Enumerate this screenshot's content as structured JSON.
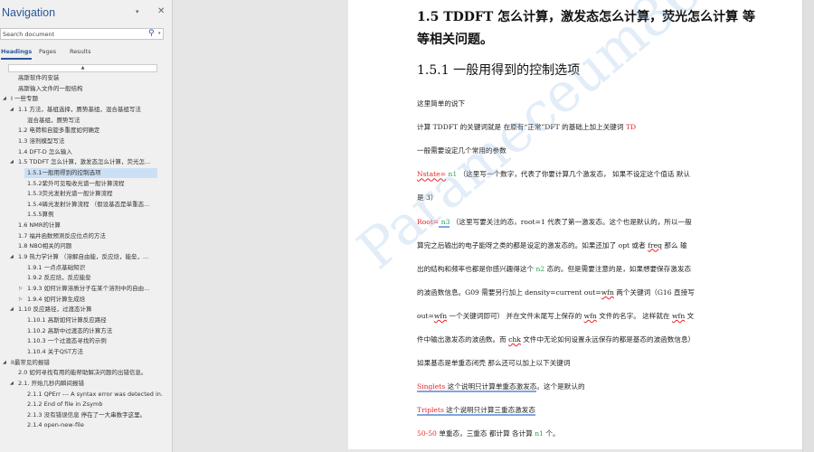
{
  "nav": {
    "title": "Navigation",
    "pin_icon": "▾",
    "close_icon": "✕",
    "search_placeholder": "Search document",
    "search_icon": "⚲",
    "search_dropdown": "▾",
    "tabs": [
      "Headings",
      "Pages",
      "Results"
    ],
    "collapse_icon": "▲",
    "items": [
      {
        "label": "高斯软件的安装",
        "level": 1
      },
      {
        "label": "高斯输入文件的一般结构",
        "level": 1
      },
      {
        "label": "I 一些专题",
        "level": 0,
        "arrow": "◢"
      },
      {
        "label": "1.1 方法，基组选择，赝势基组，混合基组写法",
        "level": 1,
        "arrow": "◢"
      },
      {
        "label": "混合基组，赝势写法",
        "level": 2
      },
      {
        "label": "1.2 电荷和自旋多重度如何确定",
        "level": 1
      },
      {
        "label": "1.3 溶剂模型写法",
        "level": 1
      },
      {
        "label": "1.4 DFT-D 怎么输入",
        "level": 1
      },
      {
        "label": "1.5 TDDFT 怎么计算，激发态怎么计算，荧光怎...",
        "level": 1,
        "arrow": "◢"
      },
      {
        "label": "1.5.1一般用得到的控制选项",
        "level": 2,
        "selected": true
      },
      {
        "label": "1.5.2紫外可见吸收光谱一般计算流程",
        "level": 2
      },
      {
        "label": "1.5.3荧光发射光谱一般计算流程",
        "level": 2
      },
      {
        "label": "1.5.4磷光发射计算流程 （假设基态是单重态...",
        "level": 2
      },
      {
        "label": "1.5.5算例",
        "level": 2
      },
      {
        "label": "1.6 NMR的计算",
        "level": 1
      },
      {
        "label": "1.7 福井函数预测反应位点的方法",
        "level": 1
      },
      {
        "label": "1.8 NBO相关的问题",
        "level": 1
      },
      {
        "label": "1.9 热力学计算 （溶解自由能，反应焓，能垒，...",
        "level": 1,
        "arrow": "◢"
      },
      {
        "label": "1.9.1 一点点基础知识",
        "level": 2
      },
      {
        "label": "1.9.2 反应焓，反应能垒",
        "level": 2
      },
      {
        "label": "1.9.3 如何计算溶质分子在某个溶剂中的自由...",
        "level": 2,
        "arrow": "▷"
      },
      {
        "label": "1.9.4 如何计算生成焓",
        "level": 2,
        "arrow": "▷"
      },
      {
        "label": "1.10 反应路径，过渡态计算",
        "level": 1,
        "arrow": "◢"
      },
      {
        "label": "1.10.1 高斯如何计算反应路径",
        "level": 2
      },
      {
        "label": "1.10.2 高斯中过渡态的计算方法",
        "level": 2
      },
      {
        "label": "1.10.3 一个过渡态寻找的示例",
        "level": 2
      },
      {
        "label": "1.10.4 关于QST方法",
        "level": 2
      },
      {
        "label": "II最常见的报错",
        "level": 0,
        "arrow": "◢"
      },
      {
        "label": "2.0 如何寻找有用的能帮助解决问题的出错信息。",
        "level": 1
      },
      {
        "label": "2.1. 开始几秒内瞬间报错",
        "level": 1,
        "arrow": "◢"
      },
      {
        "label": "2.1.1 QPErr --- A syntax error was detected in...",
        "level": 2
      },
      {
        "label": "2.1.2 End of file in Zsymb",
        "level": 2
      },
      {
        "label": "2.1.3 没有错误信息 停在了一大串数字这里。",
        "level": 2
      },
      {
        "label": "2.1.4 open-new-file",
        "level": 2
      }
    ]
  },
  "doc": {
    "heading1_line1": "1.5 TDDFT  怎么计算，激发态怎么计算，荧光怎么计算  等",
    "heading1_line2": "等相关问题。",
    "heading2": "1.5.1 一般用得到的控制选项",
    "watermark": "Parameceum86",
    "lines": [
      [
        {
          "t": "这里简单的说下"
        }
      ],
      [
        {
          "t": "计算 TDDFT 的关键词就是  在原有“正常”DFT 的基础上加上关键词 "
        },
        {
          "t": "TD",
          "c": "red"
        }
      ],
      [
        {
          "t": "一般需要设定几个常用的参数"
        }
      ],
      [
        {
          "t": "Nstate=",
          "c": "red sq"
        },
        {
          "t": " n1",
          "c": "green"
        },
        {
          "t": "  （这里写一个数字，代表了你要计算几个激发态，  如果不设定这个值话  默认"
        }
      ],
      [
        {
          "t": "是 3）"
        }
      ],
      [
        {
          "t": "Root=",
          "c": "red"
        },
        {
          "t": "   n3",
          "c": "green bu"
        },
        {
          "t": "    （这里写要关注的态，root=1 代表了第一激发态。这个也是默认的，所以一般"
        }
      ],
      [
        {
          "t": "算完之后输出的电子能呀之类的都是设定的激发态的。如果还加了  opt 或者 "
        },
        {
          "t": "freq",
          "c": "sq"
        },
        {
          "t": " 那么  输"
        }
      ],
      [
        {
          "t": "出的结构和频率也都是你感兴趣得这个 "
        },
        {
          "t": "n2",
          "c": "green"
        },
        {
          "t": " 态的。但是需要注意的是，如果想要保存激发态"
        }
      ],
      [
        {
          "t": "的波函数信息。G09 需要另行加上 density=current   out="
        },
        {
          "t": "wfn",
          "c": "sq"
        },
        {
          "t": " 两个关键词（G16  直接写"
        }
      ],
      [
        {
          "t": "out="
        },
        {
          "t": "wfn",
          "c": "sq"
        },
        {
          "t": " 一个关键词即可）   并在文件末尾写上保存的 "
        },
        {
          "t": "wfn",
          "c": "sq"
        },
        {
          "t": " 文件的名字。 这样就在 "
        },
        {
          "t": "wfn",
          "c": "sq"
        },
        {
          "t": " 文"
        }
      ],
      [
        {
          "t": "件中输出激发态的波函数。而 "
        },
        {
          "t": "chk",
          "c": "sq"
        },
        {
          "t": " 文件中无论如何设置永远保存的都是基态的波函数信息）"
        }
      ],
      [
        {
          "t": "如果基态是单重态闭壳  那么还可以加上以下关键词"
        }
      ],
      [
        {
          "t": "Singlets",
          "c": "red bu"
        },
        {
          "t": "   这个说明只计算单重态激发态",
          "c": "bu"
        },
        {
          "t": "。这个是默认的"
        }
      ],
      [
        {
          "t": "Triplets",
          "c": "red bu"
        },
        {
          "t": "   这个说明只计算三重态激发态",
          "c": "bu"
        }
      ],
      [
        {
          "t": "50-50",
          "c": "red"
        },
        {
          "t": "     单重态，三重态  都计算  各计算 "
        },
        {
          "t": "n1",
          "c": "green"
        },
        {
          "t": " 个。"
        }
      ]
    ]
  }
}
